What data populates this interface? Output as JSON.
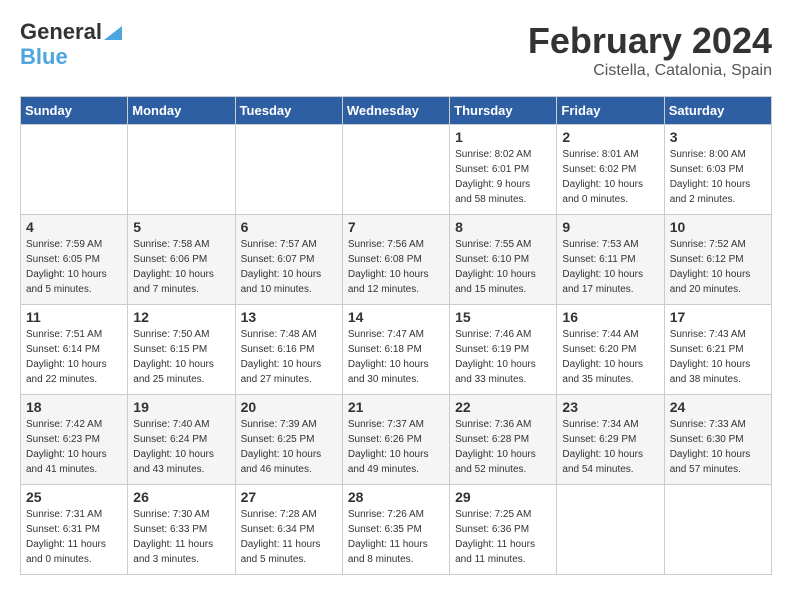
{
  "logo": {
    "general": "General",
    "blue": "Blue"
  },
  "title": "February 2024",
  "subtitle": "Cistella, Catalonia, Spain",
  "headers": [
    "Sunday",
    "Monday",
    "Tuesday",
    "Wednesday",
    "Thursday",
    "Friday",
    "Saturday"
  ],
  "weeks": [
    [
      {
        "day": "",
        "info": ""
      },
      {
        "day": "",
        "info": ""
      },
      {
        "day": "",
        "info": ""
      },
      {
        "day": "",
        "info": ""
      },
      {
        "day": "1",
        "info": "Sunrise: 8:02 AM\nSunset: 6:01 PM\nDaylight: 9 hours\nand 58 minutes."
      },
      {
        "day": "2",
        "info": "Sunrise: 8:01 AM\nSunset: 6:02 PM\nDaylight: 10 hours\nand 0 minutes."
      },
      {
        "day": "3",
        "info": "Sunrise: 8:00 AM\nSunset: 6:03 PM\nDaylight: 10 hours\nand 2 minutes."
      }
    ],
    [
      {
        "day": "4",
        "info": "Sunrise: 7:59 AM\nSunset: 6:05 PM\nDaylight: 10 hours\nand 5 minutes."
      },
      {
        "day": "5",
        "info": "Sunrise: 7:58 AM\nSunset: 6:06 PM\nDaylight: 10 hours\nand 7 minutes."
      },
      {
        "day": "6",
        "info": "Sunrise: 7:57 AM\nSunset: 6:07 PM\nDaylight: 10 hours\nand 10 minutes."
      },
      {
        "day": "7",
        "info": "Sunrise: 7:56 AM\nSunset: 6:08 PM\nDaylight: 10 hours\nand 12 minutes."
      },
      {
        "day": "8",
        "info": "Sunrise: 7:55 AM\nSunset: 6:10 PM\nDaylight: 10 hours\nand 15 minutes."
      },
      {
        "day": "9",
        "info": "Sunrise: 7:53 AM\nSunset: 6:11 PM\nDaylight: 10 hours\nand 17 minutes."
      },
      {
        "day": "10",
        "info": "Sunrise: 7:52 AM\nSunset: 6:12 PM\nDaylight: 10 hours\nand 20 minutes."
      }
    ],
    [
      {
        "day": "11",
        "info": "Sunrise: 7:51 AM\nSunset: 6:14 PM\nDaylight: 10 hours\nand 22 minutes."
      },
      {
        "day": "12",
        "info": "Sunrise: 7:50 AM\nSunset: 6:15 PM\nDaylight: 10 hours\nand 25 minutes."
      },
      {
        "day": "13",
        "info": "Sunrise: 7:48 AM\nSunset: 6:16 PM\nDaylight: 10 hours\nand 27 minutes."
      },
      {
        "day": "14",
        "info": "Sunrise: 7:47 AM\nSunset: 6:18 PM\nDaylight: 10 hours\nand 30 minutes."
      },
      {
        "day": "15",
        "info": "Sunrise: 7:46 AM\nSunset: 6:19 PM\nDaylight: 10 hours\nand 33 minutes."
      },
      {
        "day": "16",
        "info": "Sunrise: 7:44 AM\nSunset: 6:20 PM\nDaylight: 10 hours\nand 35 minutes."
      },
      {
        "day": "17",
        "info": "Sunrise: 7:43 AM\nSunset: 6:21 PM\nDaylight: 10 hours\nand 38 minutes."
      }
    ],
    [
      {
        "day": "18",
        "info": "Sunrise: 7:42 AM\nSunset: 6:23 PM\nDaylight: 10 hours\nand 41 minutes."
      },
      {
        "day": "19",
        "info": "Sunrise: 7:40 AM\nSunset: 6:24 PM\nDaylight: 10 hours\nand 43 minutes."
      },
      {
        "day": "20",
        "info": "Sunrise: 7:39 AM\nSunset: 6:25 PM\nDaylight: 10 hours\nand 46 minutes."
      },
      {
        "day": "21",
        "info": "Sunrise: 7:37 AM\nSunset: 6:26 PM\nDaylight: 10 hours\nand 49 minutes."
      },
      {
        "day": "22",
        "info": "Sunrise: 7:36 AM\nSunset: 6:28 PM\nDaylight: 10 hours\nand 52 minutes."
      },
      {
        "day": "23",
        "info": "Sunrise: 7:34 AM\nSunset: 6:29 PM\nDaylight: 10 hours\nand 54 minutes."
      },
      {
        "day": "24",
        "info": "Sunrise: 7:33 AM\nSunset: 6:30 PM\nDaylight: 10 hours\nand 57 minutes."
      }
    ],
    [
      {
        "day": "25",
        "info": "Sunrise: 7:31 AM\nSunset: 6:31 PM\nDaylight: 11 hours\nand 0 minutes."
      },
      {
        "day": "26",
        "info": "Sunrise: 7:30 AM\nSunset: 6:33 PM\nDaylight: 11 hours\nand 3 minutes."
      },
      {
        "day": "27",
        "info": "Sunrise: 7:28 AM\nSunset: 6:34 PM\nDaylight: 11 hours\nand 5 minutes."
      },
      {
        "day": "28",
        "info": "Sunrise: 7:26 AM\nSunset: 6:35 PM\nDaylight: 11 hours\nand 8 minutes."
      },
      {
        "day": "29",
        "info": "Sunrise: 7:25 AM\nSunset: 6:36 PM\nDaylight: 11 hours\nand 11 minutes."
      },
      {
        "day": "",
        "info": ""
      },
      {
        "day": "",
        "info": ""
      }
    ]
  ]
}
